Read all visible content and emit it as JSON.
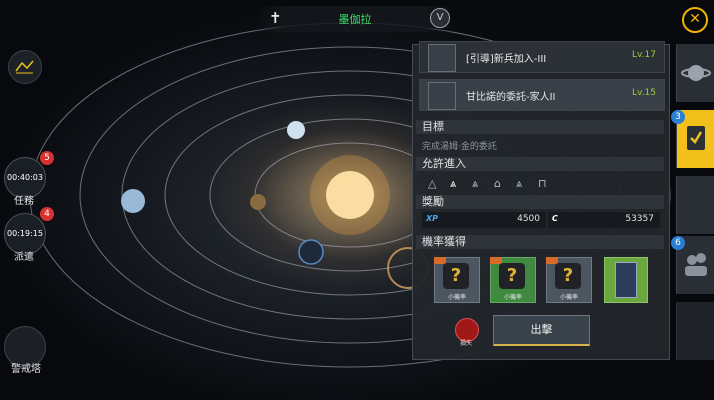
{
  "topbar": {
    "location_name": "墨伽拉",
    "cross_icon": "cross-icon",
    "toggle_label": "V"
  },
  "close_icon": "close-icon",
  "left_menu": {
    "constellation_icon": "constellation-icon",
    "tasks": {
      "label": "任務",
      "timer": "00:40:03",
      "badge": "5"
    },
    "dispatch": {
      "label": "派遣",
      "timer": "00:19:15",
      "badge": "4"
    },
    "watchtower": {
      "label": "警戒塔"
    }
  },
  "mission_panel": {
    "missions": [
      {
        "name": "[引導]新兵加入-III",
        "level": "Lv.17"
      },
      {
        "name": "甘比諾的委託-家人II",
        "level": "Lv.15"
      }
    ],
    "objective_title": "目標",
    "objective_text": "完成湯姆·金的委託",
    "entry_title": "允許進入",
    "reward_title": "獎勵",
    "xp_label": "XP",
    "xp_value": "4500",
    "credit_label": "C",
    "credit_value": "53357",
    "drop_title": "機率獲得",
    "drop_items": [
      {
        "caption": "小機率"
      },
      {
        "caption": "小機率"
      },
      {
        "caption": "小機率"
      }
    ],
    "loss_label": "損失",
    "attack_label": "出擊"
  },
  "right_tabs": {
    "active_badge": "3",
    "fleet_badge": "6"
  },
  "colors": {
    "accent_yellow": "#f2c01a",
    "location_green": "#3ee06a",
    "level_green": "#9bcf35",
    "badge_red": "#d8322f",
    "badge_blue": "#2a7fd4"
  }
}
